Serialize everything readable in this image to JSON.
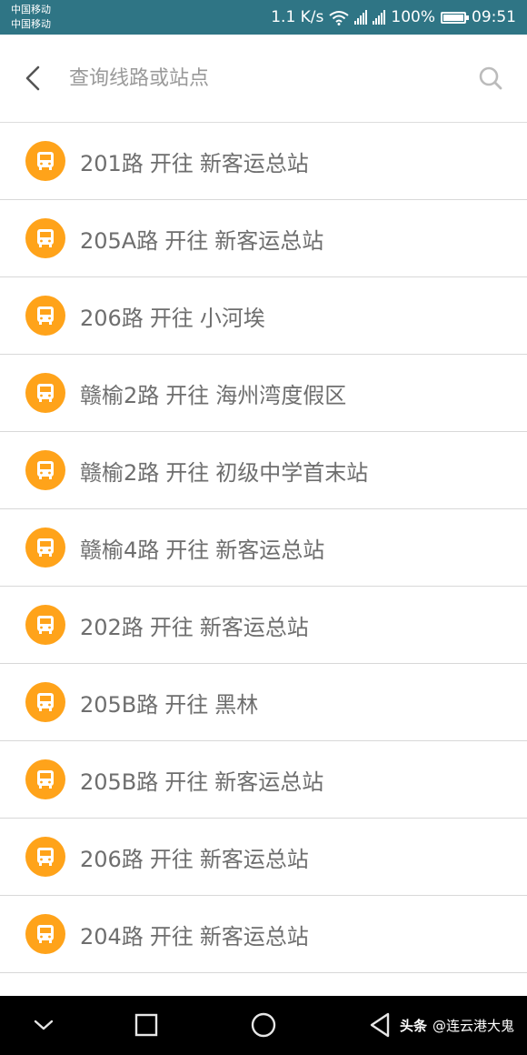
{
  "status_bar": {
    "carrier_1": "中国移动",
    "carrier_2": "中国移动",
    "net_speed": "1.1 K/s",
    "sim1_gen": "2G",
    "sim2_gen": "4G",
    "battery_pct": "100%",
    "battery_level": 1.0,
    "time": "09:51"
  },
  "search": {
    "placeholder": "查询线路或站点",
    "value": "",
    "back_icon": "chevron-left-icon",
    "search_icon": "search-icon"
  },
  "routes": [
    {
      "route": "201路",
      "towards": "开往",
      "dest": "新客运总站"
    },
    {
      "route": "205A路",
      "towards": "开往",
      "dest": "新客运总站"
    },
    {
      "route": "206路",
      "towards": "开往",
      "dest": "小河埃"
    },
    {
      "route": "赣榆2路",
      "towards": "开往",
      "dest": "海州湾度假区"
    },
    {
      "route": "赣榆2路",
      "towards": "开往",
      "dest": "初级中学首末站"
    },
    {
      "route": "赣榆4路",
      "towards": "开往",
      "dest": "新客运总站"
    },
    {
      "route": "202路",
      "towards": "开往",
      "dest": "新客运总站"
    },
    {
      "route": "205B路",
      "towards": "开往",
      "dest": "黑林"
    },
    {
      "route": "205B路",
      "towards": "开往",
      "dest": "新客运总站"
    },
    {
      "route": "206路",
      "towards": "开往",
      "dest": "新客运总站"
    },
    {
      "route": "204路",
      "towards": "开往",
      "dest": "新客运总站"
    }
  ],
  "nav_bar": {
    "icons": [
      "chevron-down-icon",
      "recents-square-icon",
      "home-circle-icon",
      "back-triangle-icon"
    ]
  },
  "watermark": {
    "brand": "头条",
    "handle": "@连云港大鬼"
  },
  "colors": {
    "status_bar": "#2f7585",
    "bus_badge": "#ffa31a",
    "route_text": "#6e6e6e",
    "divider": "#d8d8d8",
    "nav_bar": "#000000"
  }
}
